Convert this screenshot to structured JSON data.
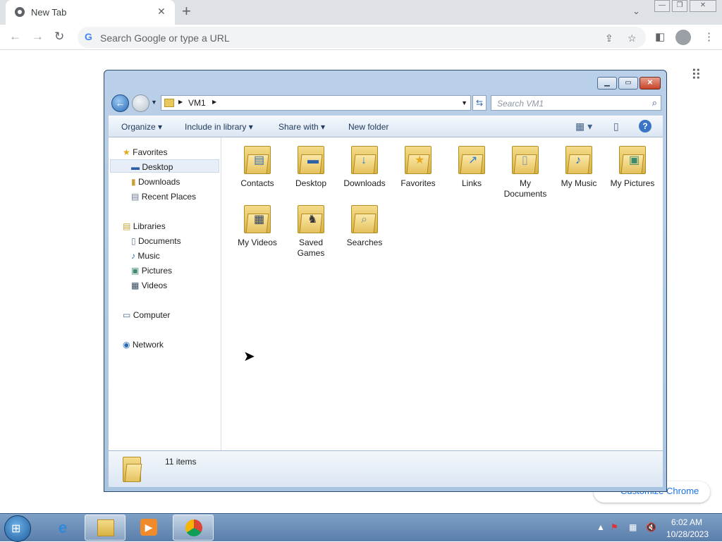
{
  "chrome": {
    "tab_title": "New Tab",
    "tab_close": "✕",
    "new_tab": "+",
    "omnibox_placeholder": "Search Google or type a URL",
    "customize_label": "Customize Chrome",
    "icons": [
      "back-icon",
      "forward-icon",
      "reload-icon",
      "google-icon",
      "share-icon",
      "star-icon",
      "side-panel-icon",
      "profile-icon",
      "menu-icon",
      "apps-grid-icon"
    ]
  },
  "explorer": {
    "address_segments": [
      "VM1"
    ],
    "search_placeholder": "Search VM1",
    "commands": {
      "organize": "Organize",
      "include_in_library": "Include in library",
      "share_with": "Share with",
      "new_folder": "New folder"
    },
    "nav": {
      "favorites": "Favorites",
      "desktop": "Desktop",
      "downloads": "Downloads",
      "recent_places": "Recent Places",
      "libraries": "Libraries",
      "documents": "Documents",
      "music": "Music",
      "pictures": "Pictures",
      "videos": "Videos",
      "computer": "Computer",
      "network": "Network"
    },
    "items": [
      {
        "name": "Contacts",
        "line1": "Contacts",
        "line2": "",
        "badge": "contacts-badge-icon"
      },
      {
        "name": "Desktop",
        "line1": "Desktop",
        "line2": "",
        "badge": "desktop-badge-icon"
      },
      {
        "name": "Downloads",
        "line1": "Downloads",
        "line2": "",
        "badge": "download-arrow-icon"
      },
      {
        "name": "Favorites",
        "line1": "Favorites",
        "line2": "",
        "badge": "star-badge-icon"
      },
      {
        "name": "Links",
        "line1": "Links",
        "line2": "",
        "badge": "link-arrow-icon"
      },
      {
        "name": "My Documents",
        "line1": "My",
        "line2": "Documents",
        "badge": "document-badge-icon"
      },
      {
        "name": "My Music",
        "line1": "My Music",
        "line2": "",
        "badge": "music-note-icon"
      },
      {
        "name": "My Pictures",
        "line1": "My Pictures",
        "line2": "",
        "badge": "picture-badge-icon"
      },
      {
        "name": "My Videos",
        "line1": "My Videos",
        "line2": "",
        "badge": "film-badge-icon"
      },
      {
        "name": "Saved Games",
        "line1": "Saved",
        "line2": "Games",
        "badge": "chess-piece-icon"
      },
      {
        "name": "Searches",
        "line1": "Searches",
        "line2": "",
        "badge": "magnifier-badge-icon"
      }
    ],
    "status_count": "11 items"
  },
  "taskbar": {
    "apps": [
      "Internet Explorer",
      "Windows Explorer",
      "Windows Media Player",
      "Google Chrome"
    ],
    "time": "6:02 AM",
    "date": "10/28/2023"
  }
}
